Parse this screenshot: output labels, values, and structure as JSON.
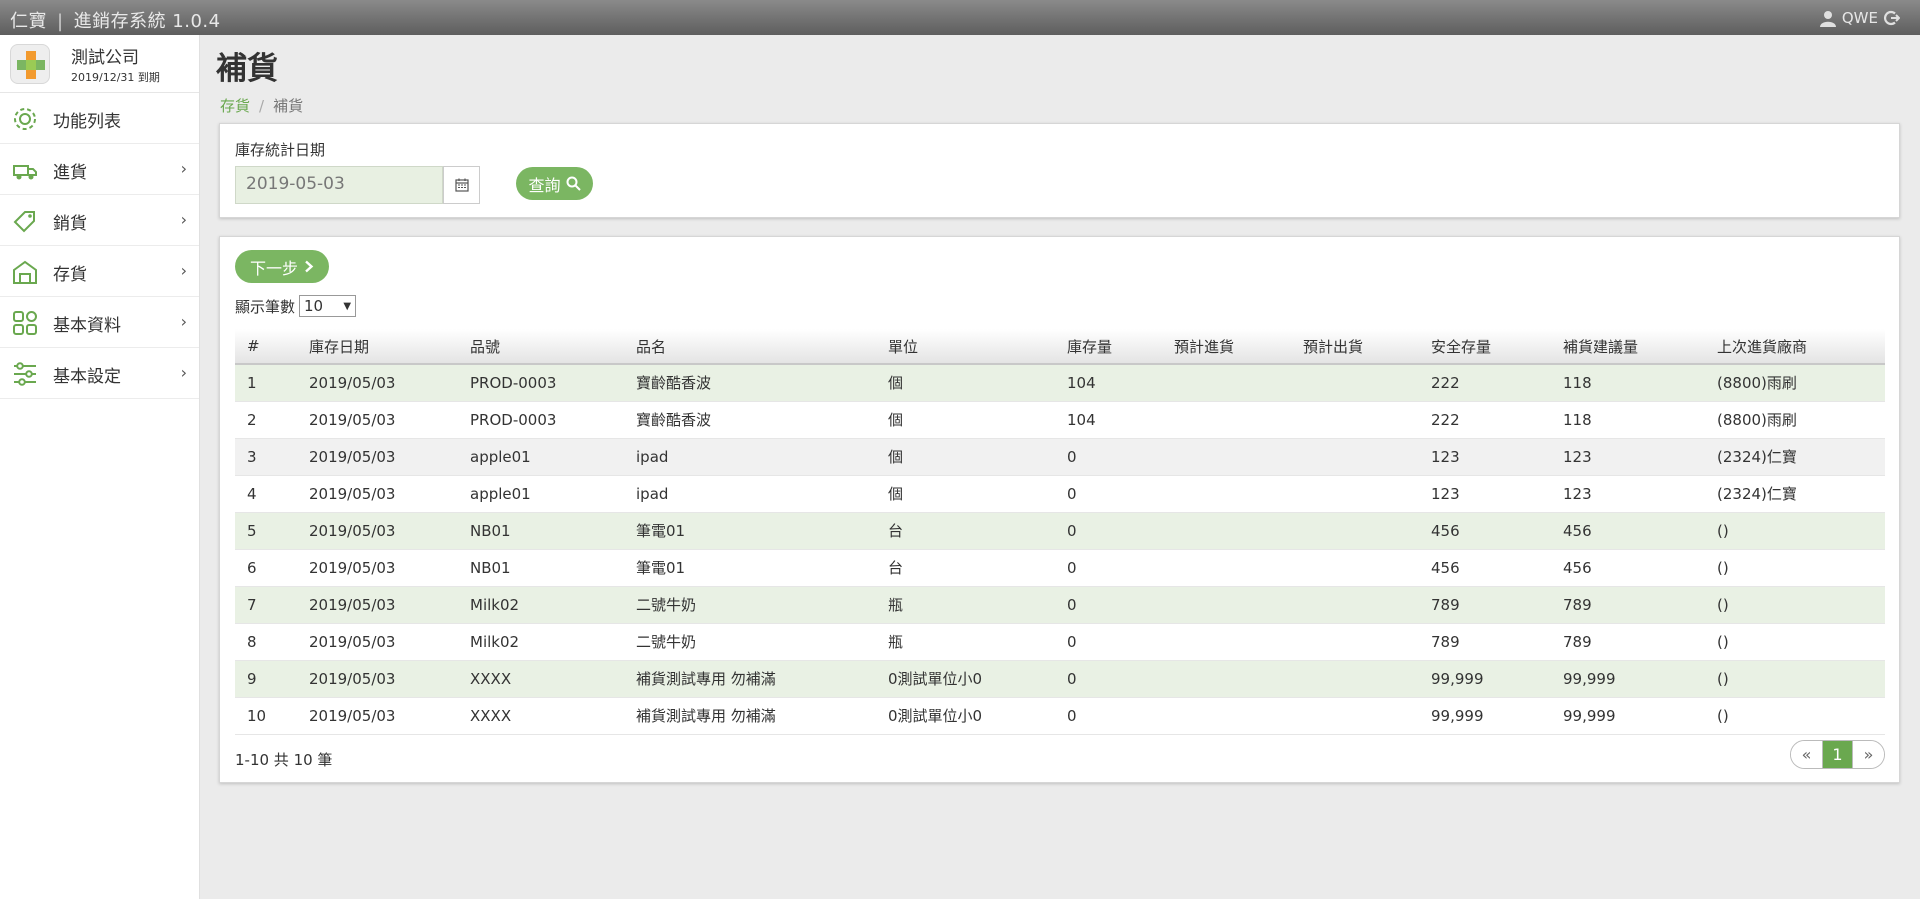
{
  "topbar": {
    "brand": "仁寶",
    "separator": "|",
    "app_name": "進銷存系統 1.0.4",
    "username": "QWE"
  },
  "sidebar": {
    "company_name": "測試公司",
    "expire_text": "2019/12/31 到期",
    "items": [
      {
        "label": "功能列表",
        "icon": "gear-icon"
      },
      {
        "label": "進貨",
        "icon": "truck-icon"
      },
      {
        "label": "銷貨",
        "icon": "tag-icon"
      },
      {
        "label": "存貨",
        "icon": "warehouse-icon"
      },
      {
        "label": "基本資料",
        "icon": "grid-icon"
      },
      {
        "label": "基本設定",
        "icon": "sliders-icon"
      }
    ]
  },
  "page": {
    "title": "補貨",
    "breadcrumb": [
      "存貨",
      "補貨"
    ]
  },
  "filter": {
    "date_label": "庫存統計日期",
    "date_value": "2019-05-03",
    "query_label": "查詢"
  },
  "toolbar": {
    "next_label": "下一步",
    "perpage_label": "顯示筆數",
    "perpage_value": "10"
  },
  "table": {
    "columns": [
      "#",
      "庫存日期",
      "品號",
      "品名",
      "單位",
      "庫存量",
      "預計進貨",
      "預計出貨",
      "安全存量",
      "補貨建議量",
      "上次進貨廠商"
    ],
    "rows": [
      [
        "1",
        "2019/05/03",
        "PROD-0003",
        "寶齡酷香波",
        "個",
        "104",
        "",
        "",
        "222",
        "118",
        "(8800)雨刷"
      ],
      [
        "2",
        "2019/05/03",
        "PROD-0003",
        "寶齡酷香波",
        "個",
        "104",
        "",
        "",
        "222",
        "118",
        "(8800)雨刷"
      ],
      [
        "3",
        "2019/05/03",
        "apple01",
        "ipad",
        "個",
        "0",
        "",
        "",
        "123",
        "123",
        "(2324)仁寶"
      ],
      [
        "4",
        "2019/05/03",
        "apple01",
        "ipad",
        "個",
        "0",
        "",
        "",
        "123",
        "123",
        "(2324)仁寶"
      ],
      [
        "5",
        "2019/05/03",
        "NB01",
        "筆電01",
        "台",
        "0",
        "",
        "",
        "456",
        "456",
        "()"
      ],
      [
        "6",
        "2019/05/03",
        "NB01",
        "筆電01",
        "台",
        "0",
        "",
        "",
        "456",
        "456",
        "()"
      ],
      [
        "7",
        "2019/05/03",
        "Milk02",
        "二號牛奶",
        "瓶",
        "0",
        "",
        "",
        "789",
        "789",
        "()"
      ],
      [
        "8",
        "2019/05/03",
        "Milk02",
        "二號牛奶",
        "瓶",
        "0",
        "",
        "",
        "789",
        "789",
        "()"
      ],
      [
        "9",
        "2019/05/03",
        "XXXX",
        "補貨測試專用 勿補滿",
        "0測試單位小0",
        "0",
        "",
        "",
        "99,999",
        "99,999",
        "()"
      ],
      [
        "10",
        "2019/05/03",
        "XXXX",
        "補貨測試專用 勿補滿",
        "0測試單位小0",
        "0",
        "",
        "",
        "99,999",
        "99,999",
        "()"
      ]
    ],
    "row_styles": [
      "alt-green",
      "",
      "alt-gray",
      "",
      "alt-green",
      "",
      "alt-green",
      "",
      "alt-green",
      ""
    ]
  },
  "footer": {
    "summary": "1-10 共 10 筆",
    "prev": "«",
    "current_page": "1",
    "next": "»"
  },
  "colors": {
    "accent_green": "#7bb662",
    "active_page": "#6aa84f",
    "row_highlight": "#e9f1e4"
  }
}
